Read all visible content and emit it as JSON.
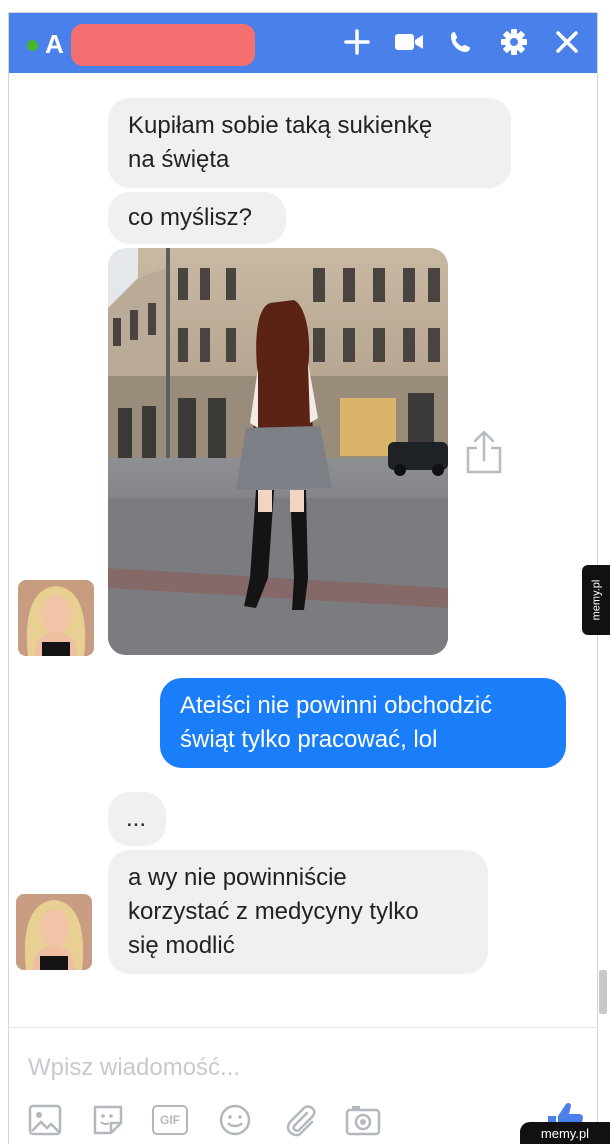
{
  "header": {
    "name": "A",
    "name_redacted": true,
    "status": "online",
    "icons": [
      "plus-icon",
      "video-camera-icon",
      "phone-icon",
      "gear-icon",
      "close-icon"
    ]
  },
  "messages": [
    {
      "from": "them",
      "text": "Kupiłam sobie taką sukienkę\nna święta"
    },
    {
      "from": "them",
      "text": "co myślisz?"
    },
    {
      "from": "them",
      "type": "image"
    },
    {
      "from": "me",
      "text": "Ateiści nie powinni obchodzić\nświąt tylko pracować, lol"
    },
    {
      "from": "them",
      "text": "..."
    },
    {
      "from": "them",
      "text": "a wy nie powinniście\nkorzystać z medycyny tylko\nsię modlić"
    }
  ],
  "composer": {
    "placeholder": "Wpisz wiadomość...",
    "tools": [
      "image-icon",
      "sticker-icon",
      "gif-icon",
      "emoji-icon",
      "attachment-icon",
      "camera-icon",
      "like-icon"
    ],
    "gif_label": "GIF"
  },
  "watermark": "memy.pl",
  "colors": {
    "header": "#4a80ea",
    "my_bubble": "#1a7efb",
    "their_bubble": "#f1f0f0",
    "online": "#42b72a",
    "redaction": "#f46f6f"
  }
}
